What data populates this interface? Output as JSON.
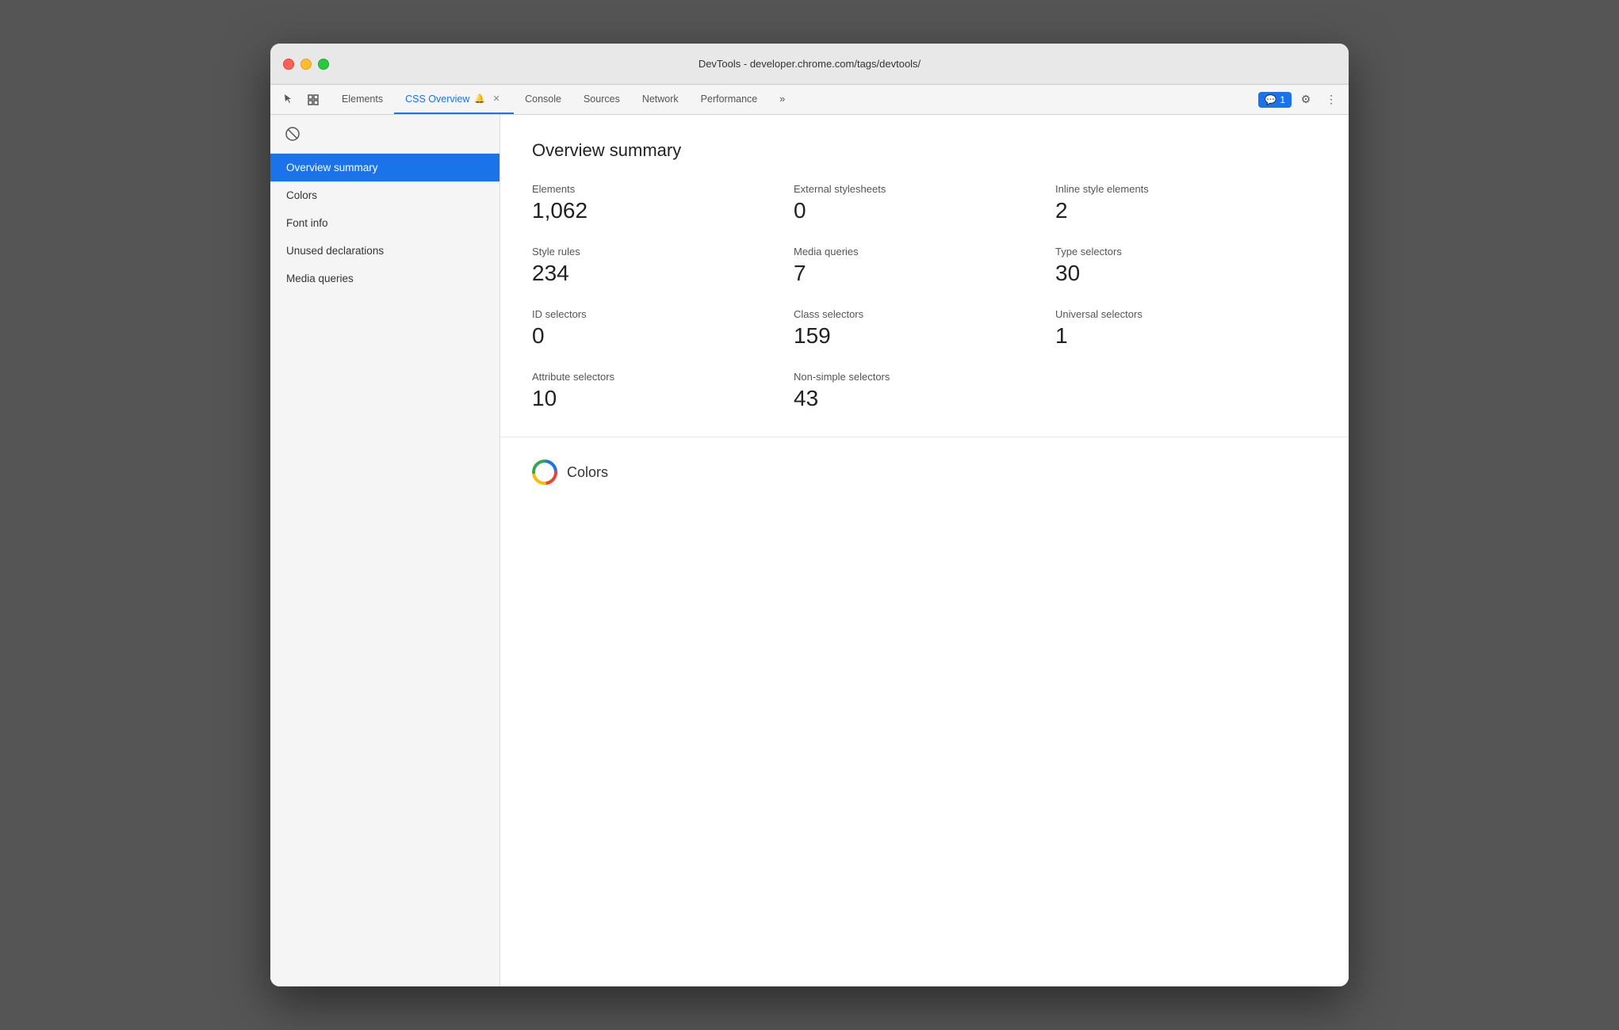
{
  "window": {
    "title": "DevTools - developer.chrome.com/tags/devtools/"
  },
  "tabs": [
    {
      "id": "elements",
      "label": "Elements",
      "active": false,
      "closable": false
    },
    {
      "id": "css-overview",
      "label": "CSS Overview",
      "active": true,
      "closable": true,
      "bell": true
    },
    {
      "id": "console",
      "label": "Console",
      "active": false,
      "closable": false
    },
    {
      "id": "sources",
      "label": "Sources",
      "active": false,
      "closable": false
    },
    {
      "id": "network",
      "label": "Network",
      "active": false,
      "closable": false
    },
    {
      "id": "performance",
      "label": "Performance",
      "active": false,
      "closable": false
    }
  ],
  "toolbar": {
    "more_label": "»",
    "badge_count": "1",
    "settings_icon": "⚙",
    "more_options_icon": "⋮"
  },
  "sidebar": {
    "block_icon": "🚫",
    "nav_items": [
      {
        "id": "overview-summary",
        "label": "Overview summary",
        "active": true
      },
      {
        "id": "colors",
        "label": "Colors",
        "active": false
      },
      {
        "id": "font-info",
        "label": "Font info",
        "active": false
      },
      {
        "id": "unused-declarations",
        "label": "Unused declarations",
        "active": false
      },
      {
        "id": "media-queries",
        "label": "Media queries",
        "active": false
      }
    ]
  },
  "overview_summary": {
    "title": "Overview summary",
    "stats": [
      {
        "label": "Elements",
        "value": "1,062"
      },
      {
        "label": "External stylesheets",
        "value": "0"
      },
      {
        "label": "Inline style elements",
        "value": "2"
      },
      {
        "label": "Style rules",
        "value": "234"
      },
      {
        "label": "Media queries",
        "value": "7"
      },
      {
        "label": "Type selectors",
        "value": "30"
      },
      {
        "label": "ID selectors",
        "value": "0"
      },
      {
        "label": "Class selectors",
        "value": "159"
      },
      {
        "label": "Universal selectors",
        "value": "1"
      },
      {
        "label": "Attribute selectors",
        "value": "10"
      },
      {
        "label": "Non-simple selectors",
        "value": "43"
      }
    ]
  },
  "colors_section": {
    "title": "Colors"
  },
  "colors": {
    "accent": "#1a73e8",
    "badge_bg": "#1a73e8"
  }
}
